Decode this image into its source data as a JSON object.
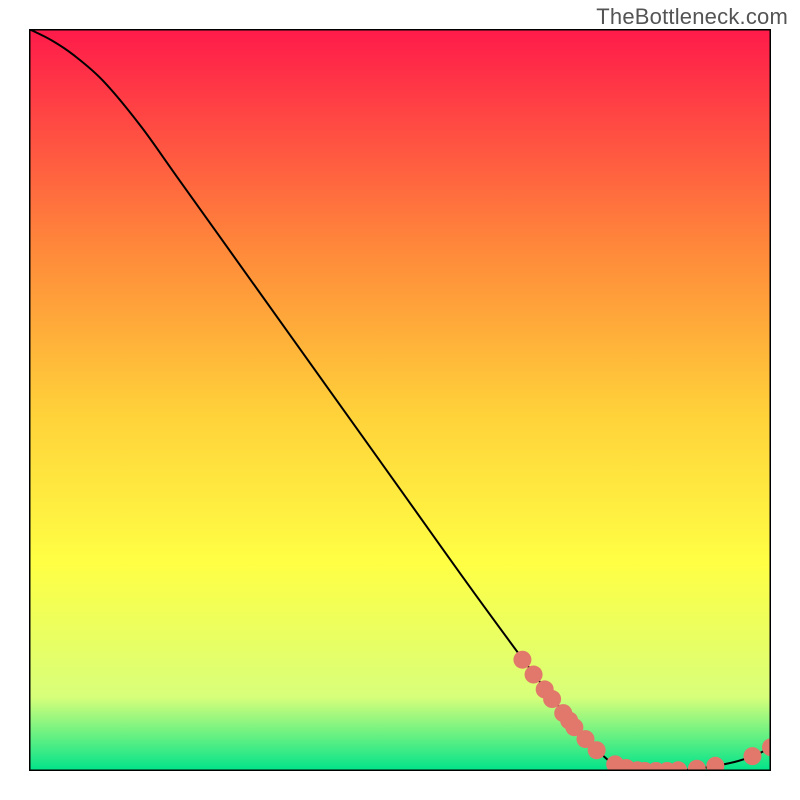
{
  "watermark": "TheBottleneck.com",
  "chart_data": {
    "type": "line",
    "title": "",
    "xlabel": "",
    "ylabel": "",
    "xlim": [
      0,
      100
    ],
    "ylim": [
      0,
      100
    ],
    "curve": [
      {
        "x": 0.0,
        "y": 100.0
      },
      {
        "x": 3.0,
        "y": 98.5
      },
      {
        "x": 6.0,
        "y": 96.5
      },
      {
        "x": 10.0,
        "y": 93.0
      },
      {
        "x": 15.0,
        "y": 87.0
      },
      {
        "x": 20.0,
        "y": 80.0
      },
      {
        "x": 30.0,
        "y": 66.0
      },
      {
        "x": 40.0,
        "y": 52.0
      },
      {
        "x": 50.0,
        "y": 38.0
      },
      {
        "x": 60.0,
        "y": 24.0
      },
      {
        "x": 70.0,
        "y": 10.5
      },
      {
        "x": 75.0,
        "y": 4.5
      },
      {
        "x": 78.0,
        "y": 1.5
      },
      {
        "x": 80.0,
        "y": 0.3
      },
      {
        "x": 85.0,
        "y": 0.0
      },
      {
        "x": 90.0,
        "y": 0.3
      },
      {
        "x": 95.0,
        "y": 1.2
      },
      {
        "x": 98.0,
        "y": 2.2
      },
      {
        "x": 100.0,
        "y": 3.2
      }
    ],
    "markers": [
      {
        "x": 66.5,
        "y": 15.0
      },
      {
        "x": 68.0,
        "y": 13.0
      },
      {
        "x": 69.5,
        "y": 11.0
      },
      {
        "x": 70.5,
        "y": 9.7
      },
      {
        "x": 72.0,
        "y": 7.8
      },
      {
        "x": 72.8,
        "y": 6.8
      },
      {
        "x": 73.5,
        "y": 5.9
      },
      {
        "x": 75.0,
        "y": 4.3
      },
      {
        "x": 76.5,
        "y": 2.8
      },
      {
        "x": 79.0,
        "y": 0.9
      },
      {
        "x": 80.5,
        "y": 0.4
      },
      {
        "x": 82.0,
        "y": 0.1
      },
      {
        "x": 83.0,
        "y": 0.0
      },
      {
        "x": 84.5,
        "y": 0.0
      },
      {
        "x": 86.0,
        "y": 0.0
      },
      {
        "x": 87.5,
        "y": 0.1
      },
      {
        "x": 90.0,
        "y": 0.3
      },
      {
        "x": 92.5,
        "y": 0.7
      },
      {
        "x": 97.5,
        "y": 2.0
      },
      {
        "x": 100.0,
        "y": 3.2
      }
    ],
    "colors": {
      "gradient_top": "#ff1a4a",
      "gradient_mid_upper": "#ff8a3a",
      "gradient_mid": "#ffd23a",
      "gradient_mid_lower": "#ffff44",
      "gradient_lower": "#d8ff7a",
      "gradient_bottom": "#00e38a",
      "curve": "#000000",
      "marker_fill": "#e2786b",
      "frame": "#000000"
    }
  }
}
